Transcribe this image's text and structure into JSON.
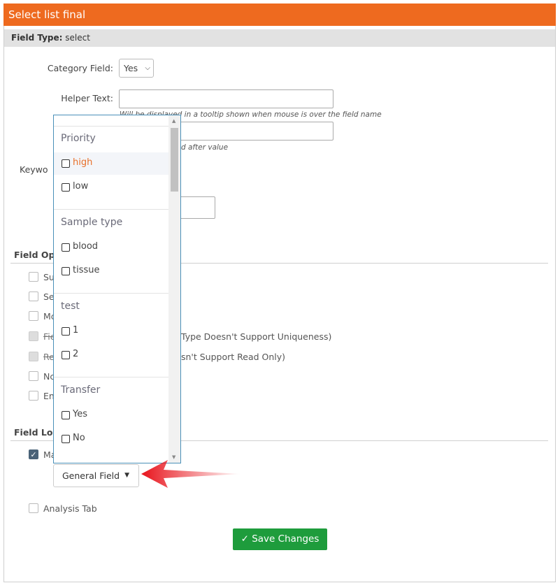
{
  "title": "Select list final",
  "field_type": {
    "label": "Field Type:",
    "value": "select"
  },
  "category_field": {
    "label": "Category Field:",
    "value": "Yes"
  },
  "helper_text": {
    "label": "Helper Text:",
    "hint": "Will be displayed in a tooltip shown when mouse is over the field name"
  },
  "unit": {
    "hint_partial": "d after value"
  },
  "keyword": {
    "label_partial": "Keywo"
  },
  "field_options": {
    "heading_partial": "Field Opt",
    "items": [
      {
        "label_partial": "Su"
      },
      {
        "label_partial": "Se"
      },
      {
        "label_partial": "Mc"
      },
      {
        "label_partial": "Fie",
        "suffix": "Type Doesn't Support Uniqueness)"
      },
      {
        "label_partial": "Re",
        "suffix": "sn't Support Read Only)"
      },
      {
        "label_partial": "Nc"
      },
      {
        "label_partial": "En"
      }
    ]
  },
  "field_location": {
    "heading_partial": "Field Loc",
    "main_partial": "Ma",
    "general_field_button": "General Field",
    "analysis_tab": "Analysis Tab"
  },
  "dropdown": {
    "groups": [
      {
        "name": "Priority",
        "items": [
          "high",
          "low"
        ]
      },
      {
        "name": "Sample type",
        "items": [
          "blood",
          "tissue"
        ]
      },
      {
        "name": "test",
        "items": [
          "1",
          "2"
        ]
      },
      {
        "name": "Transfer",
        "items": [
          "Yes",
          "No"
        ]
      }
    ]
  },
  "save_button": "Save Changes",
  "colors": {
    "accent": "#ee6a1f",
    "save": "#1e9c3c",
    "highlight_text": "#e8702a",
    "arrow": "#e8141c"
  }
}
